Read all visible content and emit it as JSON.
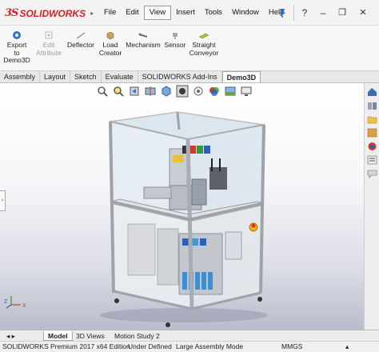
{
  "app": {
    "logo_prefix": "3S",
    "logo_text": "SOLIDWORKS",
    "brand_color": "#d41f26"
  },
  "menu": [
    "File",
    "Edit",
    "View",
    "Insert",
    "Tools",
    "Window",
    "Help"
  ],
  "menu_active": "View",
  "window_buttons": {
    "help": "?",
    "minimize": "–",
    "restore": "❐",
    "close": "✕"
  },
  "command_manager": [
    {
      "label_lines": [
        "Export",
        "to",
        "Demo3D"
      ],
      "icon": "export-icon",
      "enabled": true
    },
    {
      "label_lines": [
        "Edit",
        "Attribute"
      ],
      "icon": "edit-attribute-icon",
      "enabled": false
    },
    {
      "label_lines": [
        "Deflector"
      ],
      "icon": "deflector-icon",
      "enabled": true
    },
    {
      "label_lines": [
        "Load",
        "Creator"
      ],
      "icon": "load-creator-icon",
      "enabled": true
    },
    {
      "label_lines": [
        "Mechanism"
      ],
      "icon": "mechanism-icon",
      "enabled": true
    },
    {
      "label_lines": [
        "Sensor"
      ],
      "icon": "sensor-icon",
      "enabled": true
    },
    {
      "label_lines": [
        "Straight",
        "Conveyor"
      ],
      "icon": "straight-conveyor-icon",
      "enabled": true
    }
  ],
  "tabs": [
    "Assembly",
    "Layout",
    "Sketch",
    "Evaluate",
    "SOLIDWORKS Add-Ins",
    "Demo3D"
  ],
  "tab_active": "Demo3D",
  "flyout_label": "›",
  "bottom_tabs": [
    "Model",
    "3D Views",
    "Motion Study 2"
  ],
  "bottom_tab_active": "Model",
  "status": {
    "edition": "SOLIDWORKS Premium 2017 x64 Edition",
    "state": "Under Defined",
    "mode": "Large Assembly Mode",
    "units": "MMGS",
    "expand": "▴"
  }
}
